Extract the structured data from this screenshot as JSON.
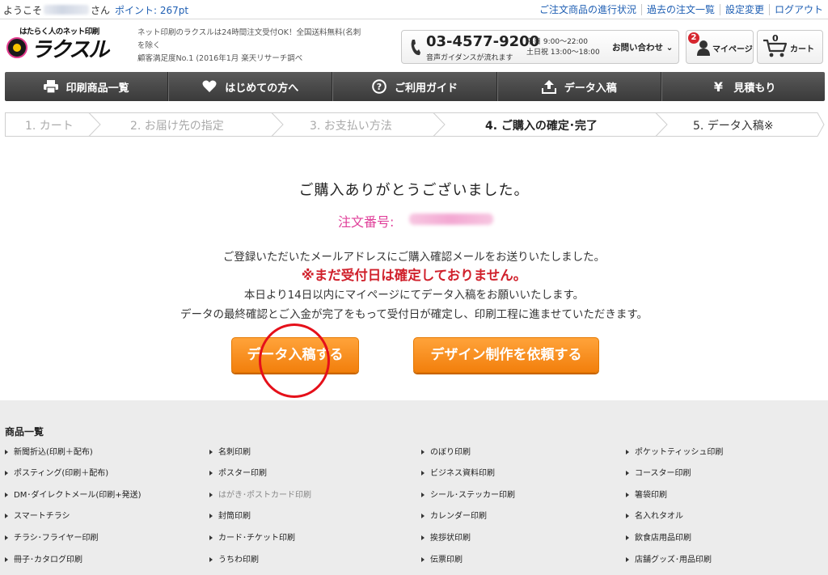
{
  "topbar": {
    "welcome_prefix": "ようこそ",
    "welcome_suffix": "さん",
    "points_label": "ポイント: 267pt",
    "links": [
      "ご注文商品の進行状況",
      "過去の注文一覧",
      "設定変更",
      "ログアウト"
    ]
  },
  "header": {
    "logo_tagline": "はたらく人のネット印刷",
    "logo_name": "ラクスル",
    "desc_line1": "ネット印刷のラクスルは24時間注文受付OK！全国送料無料(名刺",
    "desc_line2": "を除く",
    "desc_line3": "顧客満足度No.1 (2016年1月 楽天リサーチ調べ",
    "phone_number": "03-4577-9200",
    "phone_sub": "音声ガイダンスが流れます",
    "hours_weekday": "平日 9:00～22:00",
    "hours_weekend": "土日祝 13:00～18:00",
    "inquiry_label": "お問い合わせ",
    "mypage_badge": "2",
    "mypage_label": "マイページ",
    "cart_count": "0",
    "cart_label": "カート"
  },
  "nav": [
    {
      "label": "印刷商品一覧",
      "icon": "printer-icon"
    },
    {
      "label": "はじめての方へ",
      "icon": "heart-icon"
    },
    {
      "label": "ご利用ガイド",
      "icon": "question-icon"
    },
    {
      "label": "データ入稿",
      "icon": "upload-icon"
    },
    {
      "label": "見積もり",
      "icon": "yen-icon"
    }
  ],
  "steps": [
    {
      "label": "1. カート",
      "state": "done"
    },
    {
      "label": "2. お届け先の指定",
      "state": "done"
    },
    {
      "label": "3. お支払い方法",
      "state": "done"
    },
    {
      "label": "4. ご購入の確定･完了",
      "state": "active"
    },
    {
      "label": "5. データ入稿※",
      "state": "next"
    }
  ],
  "main": {
    "thanks": "ご購入ありがとうございました。",
    "order_label": "注文番号:",
    "msg1": "ご登録いただいたメールアドレスにご購入確認メールをお送りいたしました。",
    "msg_red": "※まだ受付日は確定しておりません。",
    "msg2": "本日より14日以内にマイページにてデータ入稿をお願いいたします。",
    "msg3": "データの最終確認とご入金が完了をもって受付日が確定し、印刷工程に進ませていただきます。",
    "btn_upload": "データ入稿する",
    "btn_design": "デザイン制作を依頼する"
  },
  "footer": {
    "title": "商品一覧",
    "columns": [
      [
        "新聞折込(印刷＋配布)",
        "ポスティング(印刷＋配布)",
        "DM･ダイレクトメール(印刷+発送)",
        "スマートチラシ",
        "チラシ･フライヤー印刷",
        "冊子･カタログ印刷"
      ],
      [
        "名刺印刷",
        "ポスター印刷",
        "はがき･ポストカード印刷",
        "封筒印刷",
        "カード･チケット印刷",
        "うちわ印刷"
      ],
      [
        "のぼり印刷",
        "ビジネス資料印刷",
        "シール･ステッカー印刷",
        "カレンダー印刷",
        "挨拶状印刷",
        "伝票印刷"
      ],
      [
        "ポケットティッシュ印刷",
        "コースター印刷",
        "箸袋印刷",
        "名入れタオル",
        "飲食店用品印刷",
        "店舗グッズ･用品印刷"
      ]
    ]
  },
  "colors": {
    "accent_pink": "#e0409a",
    "warning_red": "#d0202b",
    "button_orange": "#f27f0c",
    "nav_dark": "#3a3a3a",
    "link_blue": "#1f5fb3"
  }
}
